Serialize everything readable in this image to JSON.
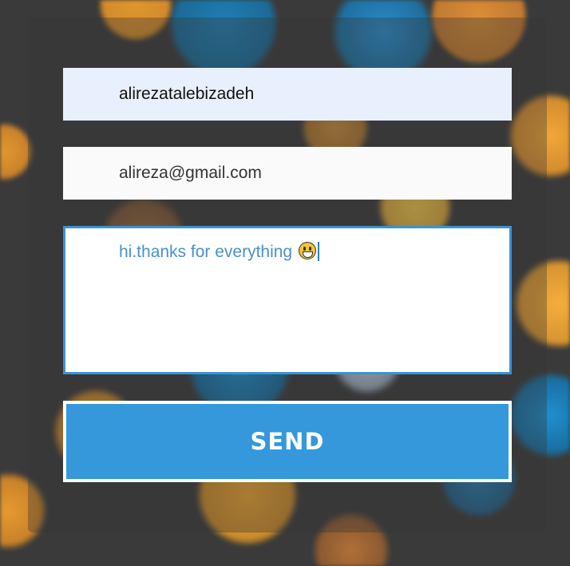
{
  "form": {
    "name_value": "alirezatalebizadeh",
    "email_value": "alireza@gmail.com",
    "message_value": "hi.thanks for everything",
    "message_emoji": "grinning-face-icon",
    "send_label": "SEND"
  },
  "colors": {
    "accent": "#3498db",
    "autofill_bg": "#e8f0fe",
    "message_text": "#4a90c8"
  }
}
